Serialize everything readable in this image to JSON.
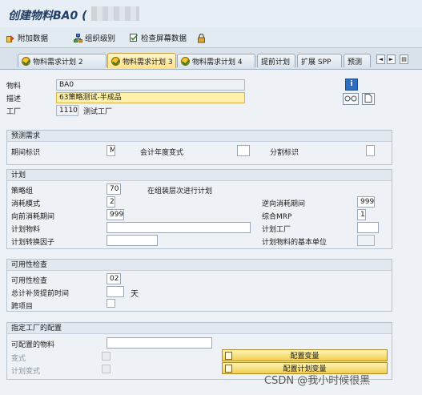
{
  "window": {
    "title": "创建物料BA0 ("
  },
  "toolbar": {
    "items": [
      {
        "label": "附加数据",
        "icon": "additional-data-icon"
      },
      {
        "label": "组织级别",
        "icon": "org-levels-icon"
      },
      {
        "label": "检查屏幕数据",
        "icon": "check-screen-icon"
      }
    ],
    "lock_icon": "lock-icon"
  },
  "tabs": [
    {
      "label": "物料需求计划 2",
      "active": false,
      "icon": "status-check-icon"
    },
    {
      "label": "物料需求计划 3",
      "active": true,
      "icon": "status-check-icon"
    },
    {
      "label": "物料需求计划 4",
      "active": false,
      "icon": "status-check-icon"
    },
    {
      "label": "提前计划",
      "active": false
    },
    {
      "label": "扩展 SPP",
      "active": false
    },
    {
      "label": "预测",
      "active": false
    }
  ],
  "nav": {
    "prev": "◄",
    "next": "►",
    "menu": "▤"
  },
  "header": {
    "material_label": "物料",
    "material_value": "BA0",
    "desc_label": "描述",
    "desc_value": "63策略测试-半成品",
    "plant_label": "工厂",
    "plant_value": "1110",
    "plant_name": "测试工厂",
    "info_icon": "i"
  },
  "groups": {
    "forecast": {
      "title": "预测需求",
      "period_label": "期间标识",
      "period_value": "M",
      "fiscal_label": "会计年度变式",
      "fiscal_value": "",
      "split_label": "分割标识",
      "split_value": ""
    },
    "planning": {
      "title": "计划",
      "strategy_label": "策略组",
      "strategy_value": "70",
      "strategy_desc": "在组装层次进行计划",
      "consumption_label": "消耗模式",
      "consumption_value": "2",
      "backward_label": "逆向消耗期间",
      "backward_value": "999",
      "forward_label": "向前消耗期间",
      "forward_value": "999",
      "mixed_label": "综合MRP",
      "mixed_value": "1",
      "planmat_label": "计划物料",
      "planmat_value": "",
      "planplant_label": "计划工厂",
      "planplant_value": "",
      "convfactor_label": "计划转换因子",
      "convfactor_value": "",
      "baseunit_label": "计划物料的基本单位",
      "baseunit_value": ""
    },
    "availability": {
      "title": "可用性检查",
      "check_label": "可用性检查",
      "check_value": "02",
      "leadtime_label": "总计补货提前时间",
      "leadtime_value": "",
      "leadtime_unit": "天",
      "crossproj_label": "跨项目"
    },
    "config": {
      "title": "指定工厂的配置",
      "configmat_label": "可配置的物料",
      "configmat_value": "",
      "variant_label": "变式",
      "planvariant_label": "计划变式",
      "config_button": "配置变量",
      "planconfig_button": "配置计划变量"
    }
  },
  "watermark": "CSDN @我小时候很黑"
}
